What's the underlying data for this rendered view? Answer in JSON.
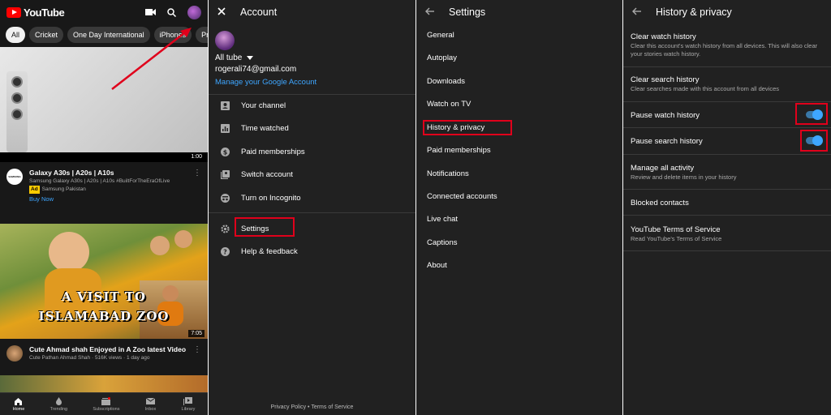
{
  "colors": {
    "highlight": "#e0001b",
    "link": "#3ea6ff",
    "panel_bg": "#212121",
    "brand_red": "#ff0000"
  },
  "home": {
    "logo_text": "YouTube",
    "chips": [
      "All",
      "Cricket",
      "One Day International",
      "iPhones",
      "Profe"
    ],
    "video1": {
      "duration": "1:00",
      "channel_avatar_text": "SAMSUNG",
      "title": "Galaxy A30s | A20s | A10s",
      "subtitle": "Samsung Galaxy A30s | A20s | A10s #BuiltForTheEraOfLive",
      "ad_label": "Ad",
      "advertiser": "Samsung Pakistan",
      "cta": "Buy Now"
    },
    "video2": {
      "thumb_line1": "A VISIT TO",
      "thumb_line2": "ISLAMABAD ZOO",
      "duration": "7:05",
      "title": "Cute Ahmad shah Enjoyed in A Zoo latest Video",
      "meta": "Cute Pathan Ahmad Shah · 516K views · 1 day ago"
    },
    "nav": [
      "Home",
      "Trending",
      "Subscriptions",
      "Inbox",
      "Library"
    ]
  },
  "account": {
    "title": "Account",
    "name": "All tube",
    "email": "rogerali74@gmail.com",
    "manage": "Manage your Google Account",
    "menu1": [
      "Your channel",
      "Time watched",
      "Paid memberships",
      "Switch account",
      "Turn on Incognito"
    ],
    "menu2": [
      "Settings",
      "Help & feedback"
    ],
    "footer": "Privacy Policy • Terms of Service"
  },
  "settings": {
    "title": "Settings",
    "items": [
      "General",
      "Autoplay",
      "Downloads",
      "Watch on TV",
      "History & privacy",
      "Paid memberships",
      "Notifications",
      "Connected accounts",
      "Live chat",
      "Captions",
      "About"
    ]
  },
  "history": {
    "title": "History & privacy",
    "items": [
      {
        "title": "Clear watch history",
        "sub": "Clear this account's watch history from all devices. This will also clear your stories watch history."
      },
      {
        "title": "Clear search history",
        "sub": "Clear searches made with this account from all devices"
      },
      {
        "title": "Pause watch history",
        "sub": "",
        "toggle": true
      },
      {
        "title": "Pause search history",
        "sub": "",
        "toggle": true
      },
      {
        "title": "Manage all activity",
        "sub": "Review and delete items in your history"
      },
      {
        "title": "Blocked contacts",
        "sub": ""
      },
      {
        "title": "YouTube Terms of Service",
        "sub": "Read YouTube's Terms of Service"
      }
    ]
  }
}
